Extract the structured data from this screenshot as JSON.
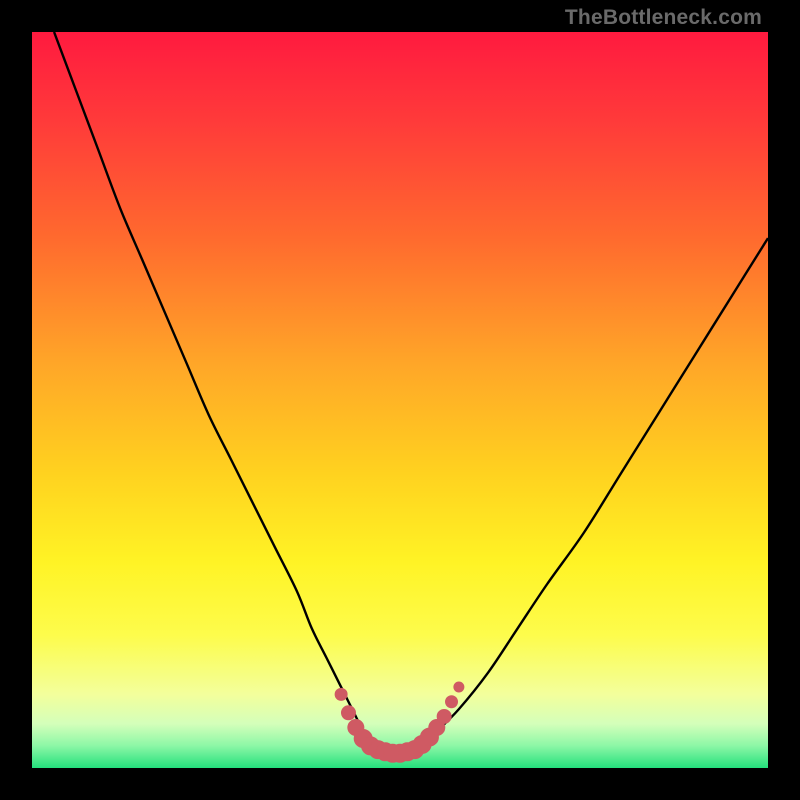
{
  "watermark": "TheBottleneck.com",
  "colors": {
    "frame_bg": "#000000",
    "gradient_stops": [
      {
        "offset": 0.0,
        "color": "#ff1a3f"
      },
      {
        "offset": 0.12,
        "color": "#ff3a3a"
      },
      {
        "offset": 0.28,
        "color": "#ff6a2e"
      },
      {
        "offset": 0.45,
        "color": "#ffa628"
      },
      {
        "offset": 0.6,
        "color": "#ffd21f"
      },
      {
        "offset": 0.72,
        "color": "#fff325"
      },
      {
        "offset": 0.82,
        "color": "#fdfc4c"
      },
      {
        "offset": 0.9,
        "color": "#f3ff9c"
      },
      {
        "offset": 0.94,
        "color": "#d4ffba"
      },
      {
        "offset": 0.97,
        "color": "#8cf7a6"
      },
      {
        "offset": 1.0,
        "color": "#24e07c"
      }
    ],
    "curve": "#000000",
    "marker_fill": "#cf5a63",
    "marker_stroke": "#cf5a63"
  },
  "chart_data": {
    "type": "line",
    "title": "",
    "xlabel": "",
    "ylabel": "",
    "xlim": [
      0,
      100
    ],
    "ylim": [
      0,
      100
    ],
    "series": [
      {
        "name": "bottleneck-curve",
        "x": [
          3,
          6,
          9,
          12,
          15,
          18,
          21,
          24,
          27,
          30,
          33,
          36,
          38,
          40,
          42,
          43,
          44,
          45,
          46,
          47,
          48,
          49,
          50,
          51,
          52,
          53,
          55,
          58,
          62,
          66,
          70,
          75,
          80,
          85,
          90,
          95,
          100
        ],
        "y": [
          100,
          92,
          84,
          76,
          69,
          62,
          55,
          48,
          42,
          36,
          30,
          24,
          19,
          15,
          11,
          9,
          7,
          5,
          4,
          3,
          2.5,
          2.2,
          2,
          2.2,
          2.6,
          3.2,
          5,
          8,
          13,
          19,
          25,
          32,
          40,
          48,
          56,
          64,
          72
        ]
      }
    ],
    "markers": {
      "name": "bottom-cluster",
      "points": [
        {
          "x": 42.0,
          "y": 10.0,
          "r": 6
        },
        {
          "x": 43.0,
          "y": 7.5,
          "r": 7
        },
        {
          "x": 44.0,
          "y": 5.5,
          "r": 8
        },
        {
          "x": 45.0,
          "y": 4.0,
          "r": 9
        },
        {
          "x": 46.0,
          "y": 3.0,
          "r": 9
        },
        {
          "x": 47.0,
          "y": 2.5,
          "r": 9
        },
        {
          "x": 48.0,
          "y": 2.2,
          "r": 9
        },
        {
          "x": 49.0,
          "y": 2.0,
          "r": 9
        },
        {
          "x": 50.0,
          "y": 2.0,
          "r": 9
        },
        {
          "x": 51.0,
          "y": 2.2,
          "r": 9
        },
        {
          "x": 52.0,
          "y": 2.5,
          "r": 9
        },
        {
          "x": 53.0,
          "y": 3.2,
          "r": 9
        },
        {
          "x": 54.0,
          "y": 4.2,
          "r": 9
        },
        {
          "x": 55.0,
          "y": 5.5,
          "r": 8
        },
        {
          "x": 56.0,
          "y": 7.0,
          "r": 7
        },
        {
          "x": 57.0,
          "y": 9.0,
          "r": 6
        },
        {
          "x": 58.0,
          "y": 11.0,
          "r": 5
        }
      ]
    }
  }
}
